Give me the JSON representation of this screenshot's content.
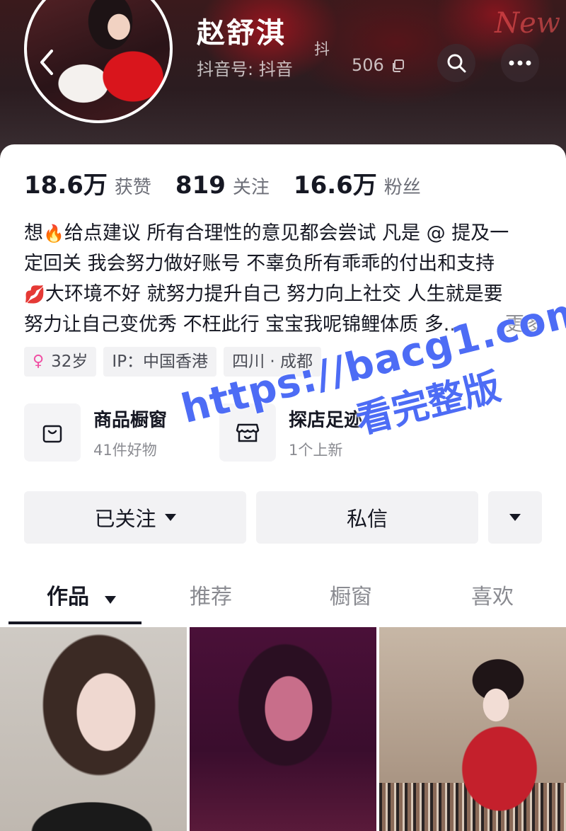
{
  "header": {
    "profile_name": "赵舒淇",
    "douyin_id_prefix": "抖音号: 抖音",
    "douyin_id_partial": "抖",
    "douyin_id_suffix": "506",
    "banner_text": "New"
  },
  "stats": [
    {
      "value": "18.6万",
      "label": "获赞"
    },
    {
      "value": "819",
      "label": "关注"
    },
    {
      "value": "16.6万",
      "label": "粉丝"
    }
  ],
  "bio": {
    "line1_a": "想",
    "line1_emoji": "🔥",
    "line1_b": "给点建议 所有合理性的意见都会尝试 凡是 @ 提及一",
    "line2": "定回关 我会努力做好账号 不辜负所有乖乖的付出和支持",
    "line3_emoji": "💋",
    "line3": "大环境不好 就努力提升自己 努力向上社交 人生就是要",
    "line4": "努力让自己变优秀 不枉此行 宝宝我呢锦鲤体质 多...",
    "more": "更多"
  },
  "tags": {
    "age": "32岁",
    "ip": "IP：中国香港",
    "location": "四川 · 成都"
  },
  "features": [
    {
      "title": "商品橱窗",
      "subtitle": "41件好物",
      "icon": "shopping-bag-icon"
    },
    {
      "title": "探店足迹",
      "subtitle": "1个上新",
      "icon": "storefront-icon"
    }
  ],
  "actions": {
    "follow_label": "已关注",
    "message_label": "私信"
  },
  "tabs": [
    {
      "label": "作品",
      "active": true
    },
    {
      "label": "推荐",
      "active": false
    },
    {
      "label": "橱窗",
      "active": false
    },
    {
      "label": "喜欢",
      "active": false
    }
  ],
  "watermark": {
    "url": "https://bacg1.com",
    "sub": "看完整版"
  },
  "colors": {
    "accent_text": "#161823",
    "muted_text": "#8a8b91",
    "watermark": "#4d6cf5",
    "female_pink": "#f04fa3"
  }
}
